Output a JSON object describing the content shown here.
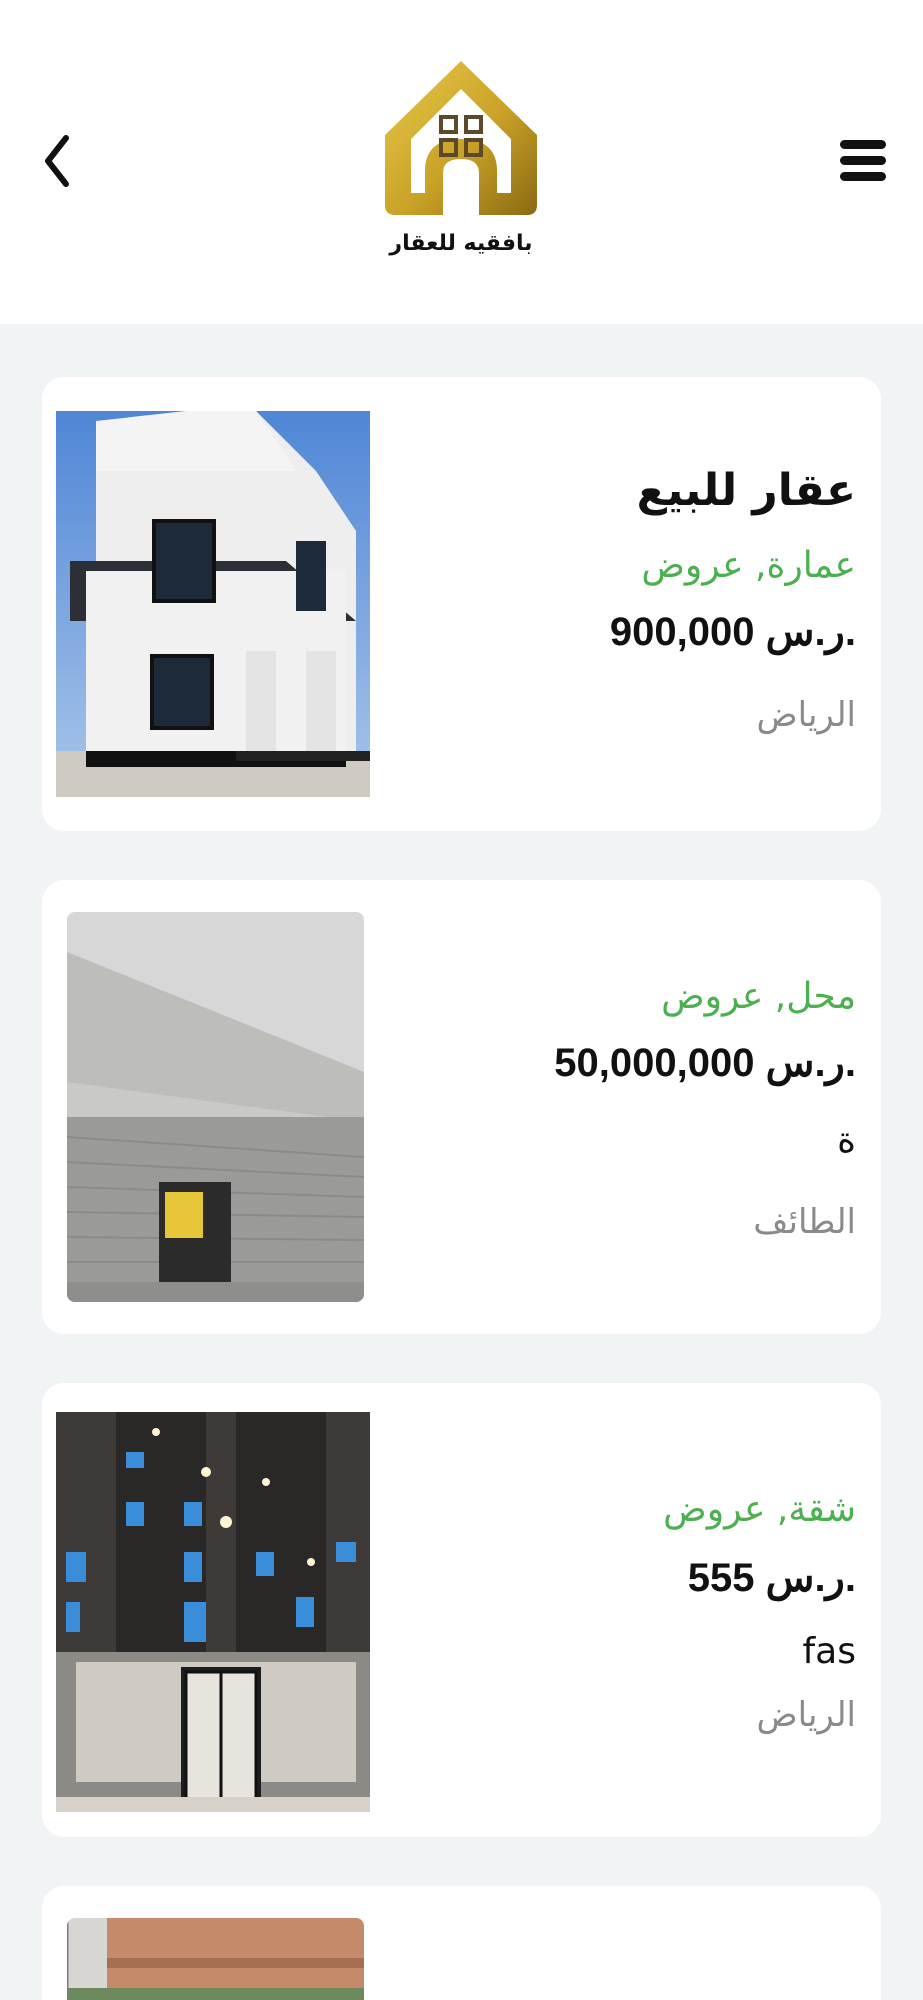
{
  "header": {
    "logo_text": "بافقيه للعقار",
    "menu_icon": "hamburger-menu-icon",
    "back_icon": "chevron-left-icon"
  },
  "colors": {
    "gold": "#c9a227",
    "green": "#4caf50",
    "background": "#f1f4f5"
  },
  "listings": [
    {
      "title": "عقار للبيع",
      "categories": "عمارة, عروض",
      "price": "900,000 ر.س.",
      "description": "",
      "city": "الرياض"
    },
    {
      "title": "",
      "categories": "محل, عروض",
      "price": "50,000,000 ر.س.",
      "description": "ة",
      "city": "الطائف"
    },
    {
      "title": "",
      "categories": "شقة, عروض",
      "price": "555 ر.س.",
      "description": "fas",
      "city": "الرياض"
    },
    {
      "title": "",
      "categories": "",
      "price": "",
      "description": "",
      "city": ""
    }
  ]
}
